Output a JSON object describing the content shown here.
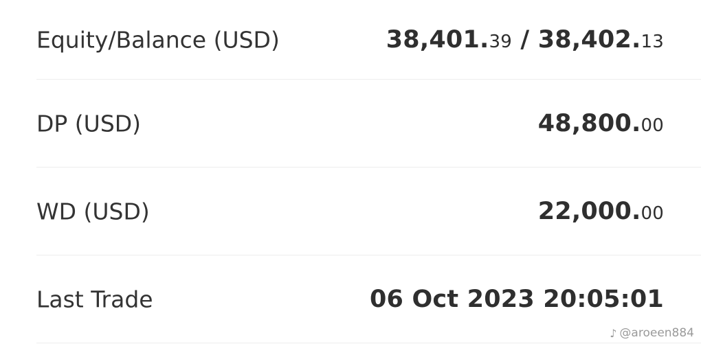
{
  "rows": [
    {
      "label": "Equity/Balance (USD)",
      "equity_int": "38,401.",
      "equity_dec": "39",
      "separator": " / ",
      "balance_int": "38,402.",
      "balance_dec": "13"
    },
    {
      "label": "DP (USD)",
      "value_int": "48,800.",
      "value_dec": "00"
    },
    {
      "label": "WD (USD)",
      "value_int": "22,000.",
      "value_dec": "00"
    },
    {
      "label": "Last Trade",
      "value": "06 Oct 2023 20:05:01"
    }
  ],
  "watermark": {
    "icon": "music-note-icon",
    "glyph": "♪",
    "text": "@aroeen884"
  }
}
